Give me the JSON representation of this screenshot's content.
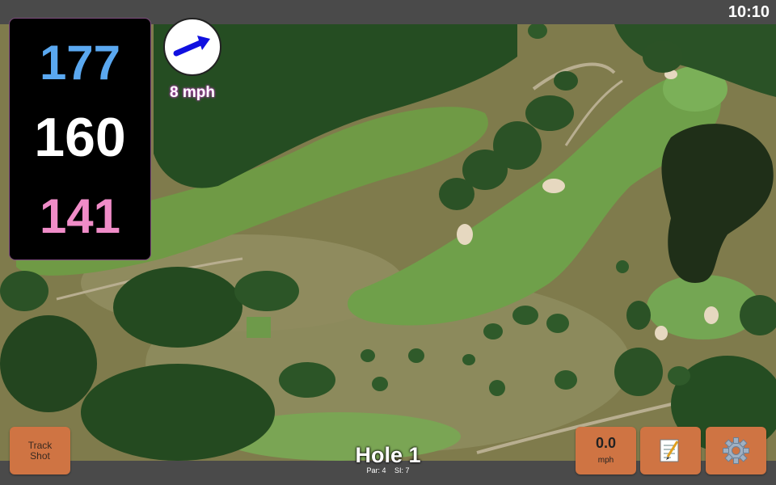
{
  "status": {
    "time": "10:10"
  },
  "distances": {
    "back": "177",
    "middle": "160",
    "front": "141"
  },
  "wind": {
    "speed": "8 mph",
    "arrow_color": "#1010e0",
    "direction_icon": "arrow-icon"
  },
  "hole": {
    "title": "Hole 1",
    "par": "Par: 4",
    "stroke_index": "SI: 7"
  },
  "buttons": {
    "track_shot_line1": "Track",
    "track_shot_line2": "Shot",
    "speed_value": "0.0",
    "speed_unit": "mph",
    "notes_icon": "notepad-icon",
    "settings_icon": "gear-icon"
  },
  "colors": {
    "back_distance": "#5aa8f0",
    "middle_distance": "#ffffff",
    "front_distance": "#f08cc8",
    "button": "#cf7443",
    "bar": "#4a4a4a"
  }
}
